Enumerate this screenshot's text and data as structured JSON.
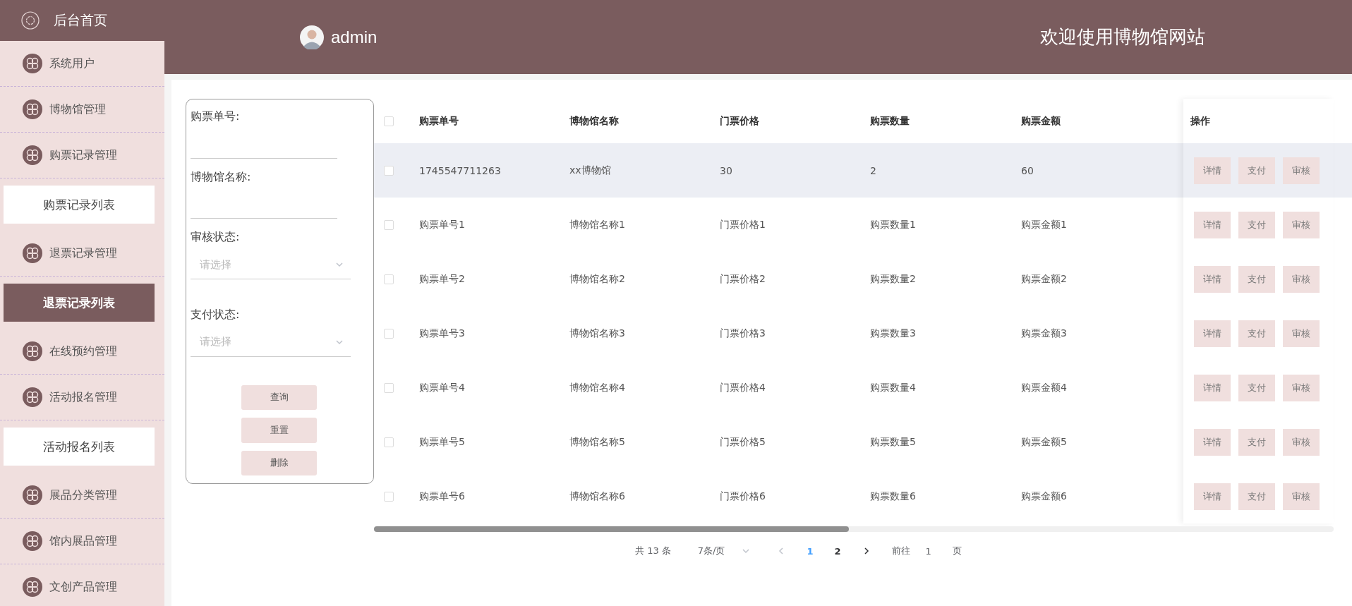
{
  "sidebar": {
    "home": "后台首页",
    "items": [
      {
        "kind": "menu",
        "label": "系统用户",
        "selected": false
      },
      {
        "kind": "menu",
        "label": "博物馆管理",
        "selected": false
      },
      {
        "kind": "menu",
        "label": "购票记录管理",
        "selected": false
      },
      {
        "kind": "submenu",
        "label": "购票记录列表",
        "selected": false
      },
      {
        "kind": "menu",
        "label": "退票记录管理",
        "selected": false
      },
      {
        "kind": "submenu",
        "label": "退票记录列表",
        "selected": true
      },
      {
        "kind": "menu",
        "label": "在线预约管理",
        "selected": false
      },
      {
        "kind": "menu",
        "label": "活动报名管理",
        "selected": false
      },
      {
        "kind": "submenu",
        "label": "活动报名列表",
        "selected": false
      },
      {
        "kind": "menu",
        "label": "展品分类管理",
        "selected": false
      },
      {
        "kind": "menu",
        "label": "馆内展品管理",
        "selected": false
      },
      {
        "kind": "menu",
        "label": "文创产品管理",
        "selected": false
      }
    ]
  },
  "header": {
    "user": "admin",
    "title": "欢迎使用博物馆网站"
  },
  "filters": [
    {
      "kind": "input",
      "label": "购票单号:"
    },
    {
      "kind": "input",
      "label": "博物馆名称:"
    },
    {
      "kind": "select",
      "label": "审核状态:",
      "placeholder": "请选择"
    },
    {
      "kind": "select",
      "label": "支付状态:",
      "placeholder": "请选择"
    }
  ],
  "filter_buttons": [
    "查询",
    "重置",
    "删除"
  ],
  "table": {
    "all_checked": false,
    "columns": [
      "购票单号",
      "博物馆名称",
      "门票价格",
      "购票数量",
      "购票金额"
    ],
    "actions_heading": "操作",
    "rows": [
      {
        "checked": false,
        "highlighted": true,
        "cells": [
          "1745547711263",
          "xx博物馆",
          "30",
          "2",
          "60"
        ],
        "actions": [
          "详情",
          "支付",
          "审核"
        ]
      },
      {
        "checked": false,
        "highlighted": false,
        "cells": [
          "购票单号1",
          "博物馆名称1",
          "门票价格1",
          "购票数量1",
          "购票金额1"
        ],
        "actions": [
          "详情",
          "支付",
          "审核"
        ]
      },
      {
        "checked": false,
        "highlighted": false,
        "cells": [
          "购票单号2",
          "博物馆名称2",
          "门票价格2",
          "购票数量2",
          "购票金额2"
        ],
        "actions": [
          "详情",
          "支付",
          "审核"
        ]
      },
      {
        "checked": false,
        "highlighted": false,
        "cells": [
          "购票单号3",
          "博物馆名称3",
          "门票价格3",
          "购票数量3",
          "购票金额3"
        ],
        "actions": [
          "详情",
          "支付",
          "审核"
        ]
      },
      {
        "checked": false,
        "highlighted": false,
        "cells": [
          "购票单号4",
          "博物馆名称4",
          "门票价格4",
          "购票数量4",
          "购票金额4"
        ],
        "actions": [
          "详情",
          "支付",
          "审核"
        ]
      },
      {
        "checked": false,
        "highlighted": false,
        "cells": [
          "购票单号5",
          "博物馆名称5",
          "门票价格5",
          "购票数量5",
          "购票金额5"
        ],
        "actions": [
          "详情",
          "支付",
          "审核"
        ]
      },
      {
        "checked": false,
        "highlighted": false,
        "cells": [
          "购票单号6",
          "博物馆名称6",
          "门票价格6",
          "购票数量6",
          "购票金额6"
        ],
        "actions": [
          "详情",
          "支付",
          "审核"
        ]
      }
    ]
  },
  "pagination": {
    "total": "共 13 条",
    "page_size": "7条/页",
    "pages": [
      {
        "label": "1",
        "selected": true
      },
      {
        "label": "2",
        "selected": false
      }
    ],
    "goto_label": "前往",
    "goto_value": "1",
    "goto_suffix": "页"
  }
}
